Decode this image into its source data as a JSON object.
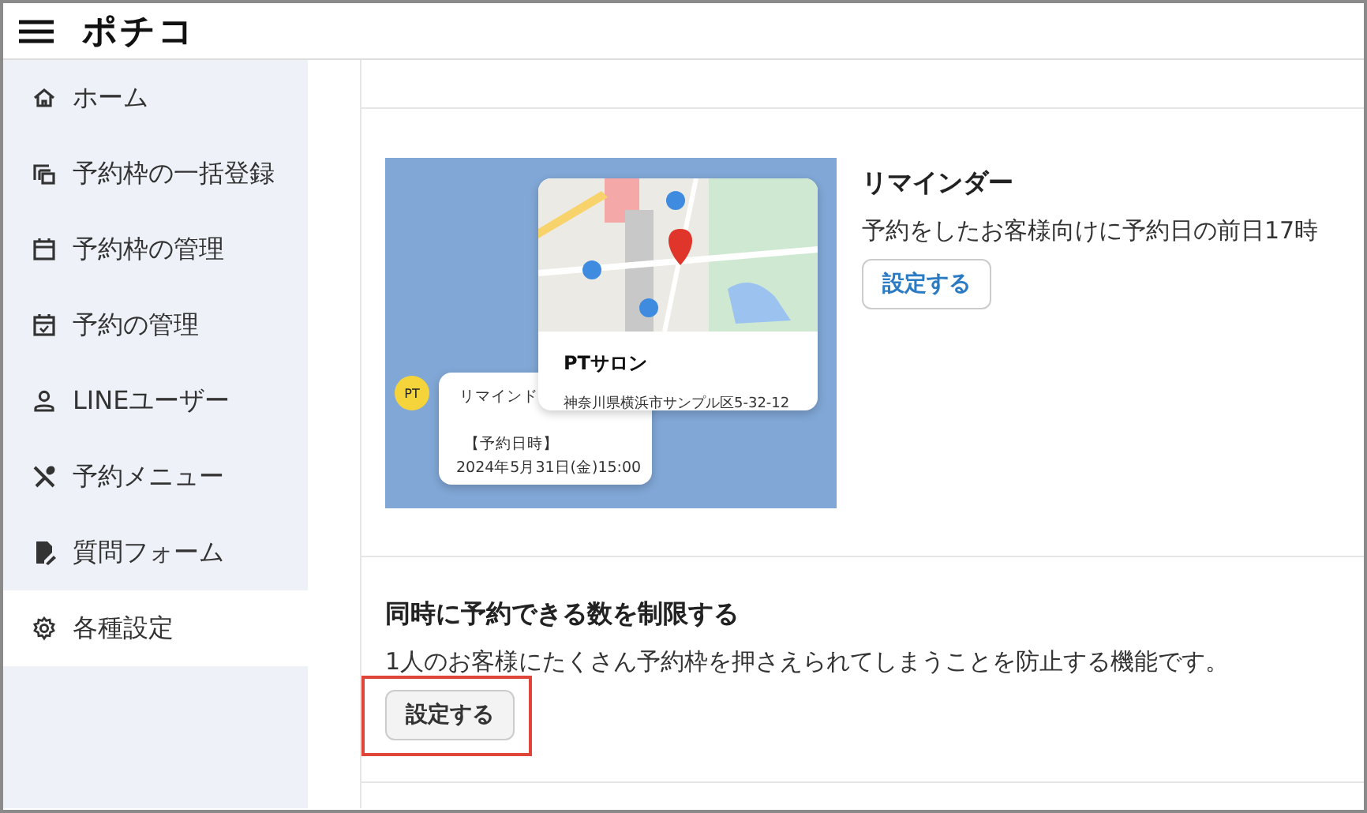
{
  "app": {
    "title": "ポチコ"
  },
  "sidebar": {
    "items": [
      {
        "label": "ホーム",
        "selected": false
      },
      {
        "label": "予約枠の一括登録",
        "selected": false
      },
      {
        "label": "予約枠の管理",
        "selected": false
      },
      {
        "label": "予約の管理",
        "selected": false
      },
      {
        "label": "LINEユーザー",
        "selected": false
      },
      {
        "label": "予約メニュー",
        "selected": false
      },
      {
        "label": "質問フォーム",
        "selected": false
      },
      {
        "label": "各種設定",
        "selected": true
      }
    ]
  },
  "sections": [
    {
      "kind": "illustrated",
      "title": "リマインダー",
      "description": "予約をしたお客様向けに予約日の前日17時",
      "button": "設定する",
      "highlighted": false,
      "illustration": {
        "avatar": "PT",
        "message_lines": [
          "リマインド",
          "【予約日時】",
          "2024年5月31日(金)15:00"
        ],
        "place_card": {
          "name": "PTサロン",
          "address": "神奈川県横浜市サンプル区5-32-12"
        }
      }
    },
    {
      "kind": "plain",
      "title": "同時に予約できる数を制限する",
      "description": "1人のお客様にたくさん予約枠を押さえられてしまうことを防止する機能です。",
      "button": "設定する",
      "highlighted": true
    }
  ]
}
